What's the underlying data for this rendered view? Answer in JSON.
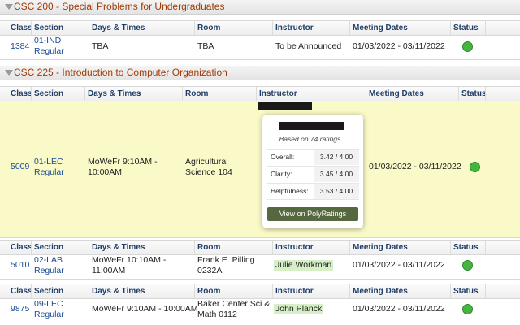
{
  "headers": {
    "class": "Class",
    "section": "Section",
    "days_times": "Days & Times",
    "room": "Room",
    "instructor": "Instructor",
    "meeting_dates": "Meeting Dates",
    "status": "Status"
  },
  "course1": {
    "title": "CSC 200 - Special Problems for Undergraduates",
    "rows": [
      {
        "class": "1384",
        "section_line1": "01-IND",
        "section_line2": "Regular",
        "days_times": "TBA",
        "room": "TBA",
        "instructor": "To be Announced",
        "meeting_dates": "01/03/2022 - 03/11/2022",
        "status": "open"
      }
    ]
  },
  "course2": {
    "title": "CSC 225 - Introduction to Computer Organization",
    "rows": [
      {
        "class": "5009",
        "section_line1": "01-LEC",
        "section_line2": "Regular",
        "days_line1": "MoWeFr 9:10AM -",
        "days_line2": "10:00AM",
        "room_line1": "Agricultural",
        "room_line2": "Science 104",
        "meeting_dates": "01/03/2022 - 03/11/2022",
        "status": "open"
      },
      {
        "class": "5010",
        "section_line1": "02-LAB",
        "section_line2": "Regular",
        "days_line1": "MoWeFr 10:10AM -",
        "days_line2": "11:00AM",
        "room_line1": "Frank E. Pilling",
        "room_line2": "0232A",
        "instructor": "Julie Workman",
        "meeting_dates": "01/03/2022 - 03/11/2022",
        "status": "open"
      },
      {
        "class": "9875",
        "section_line1": "09-LEC",
        "section_line2": "Regular",
        "days_line1": "MoWeFr 9:10AM - 10:00AM",
        "room_line1": "Baker Center Sci &",
        "room_line2": "Math 0112",
        "instructor": "John Planck",
        "meeting_dates": "01/03/2022 - 03/11/2022",
        "status": "open"
      }
    ]
  },
  "polyratings_popup": {
    "based_on": "Based on 74 ratings...",
    "ratings": [
      {
        "label": "Overall:",
        "value": "3.42 / 4.00"
      },
      {
        "label": "Clarity:",
        "value": "3.45 / 4.00"
      },
      {
        "label": "Helpfulness:",
        "value": "3.53 / 4.00"
      }
    ],
    "button_label": "View on PolyRatings"
  },
  "colors": {
    "course_title": "#a03c08",
    "header_text": "#1f3d67",
    "link": "#1a4a94",
    "highlight_row": "#fafac8",
    "status_open": "#47b43f",
    "instructor_highlight": "#d7efc6",
    "button": "#56683f"
  }
}
